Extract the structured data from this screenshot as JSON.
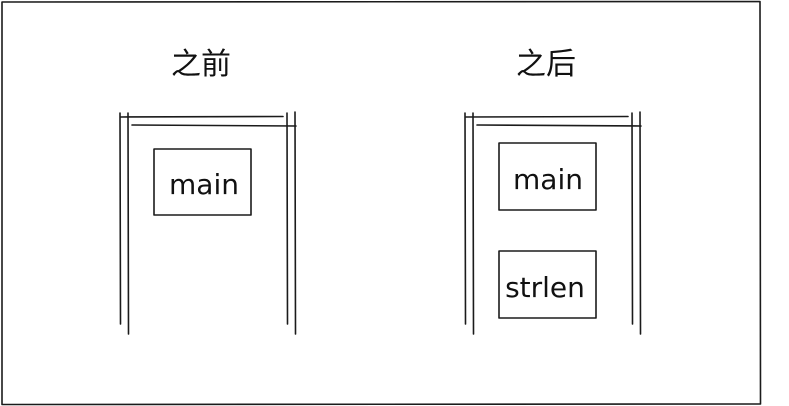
{
  "before": {
    "title": "之前",
    "frames": [
      {
        "label": "main"
      }
    ]
  },
  "after": {
    "title": "之后",
    "frames": [
      {
        "label": "main"
      },
      {
        "label": "strlen"
      }
    ]
  }
}
